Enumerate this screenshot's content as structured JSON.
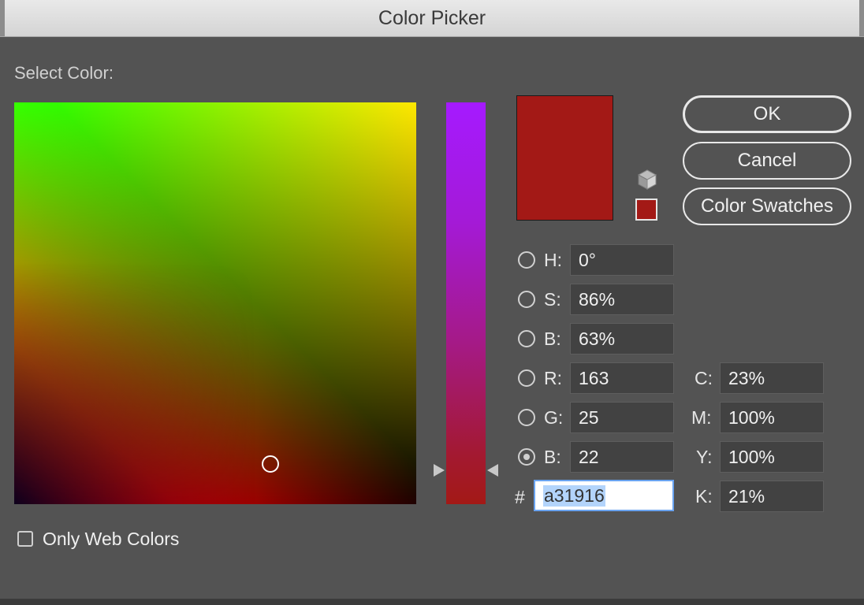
{
  "window": {
    "title": "Color Picker"
  },
  "section_label": "Select Color:",
  "buttons": {
    "ok": "OK",
    "cancel": "Cancel",
    "swatches": "Color Swatches"
  },
  "hsb": [
    {
      "label": "H:",
      "value": "0°",
      "selected": false
    },
    {
      "label": "S:",
      "value": "86%",
      "selected": false
    },
    {
      "label": "B:",
      "value": "63%",
      "selected": false
    }
  ],
  "rgb": [
    {
      "label": "R:",
      "value": "163",
      "selected": false
    },
    {
      "label": "G:",
      "value": "25",
      "selected": false
    },
    {
      "label": "B:",
      "value": "22",
      "selected": true
    }
  ],
  "cmyk": [
    {
      "label": "C:",
      "value": "23%"
    },
    {
      "label": "M:",
      "value": "100%"
    },
    {
      "label": "Y:",
      "value": "100%"
    },
    {
      "label": "K:",
      "value": "21%"
    }
  ],
  "hex": {
    "label": "#",
    "value": "a31916"
  },
  "web_colors": {
    "label": "Only Web Colors",
    "checked": false
  },
  "colors": {
    "current": "#a31916",
    "accent_focus": "#6aa3f0"
  },
  "icons": {
    "gamut": "cube-icon"
  }
}
